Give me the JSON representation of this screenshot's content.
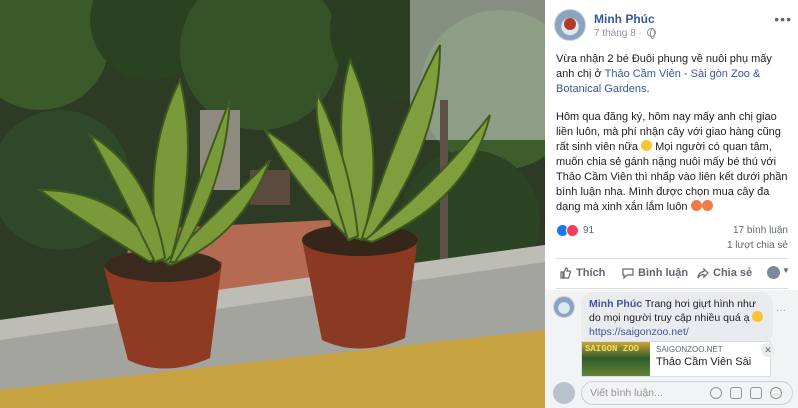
{
  "post": {
    "author": "Minh Phúc",
    "date": "7 tháng 8 ·",
    "more": "•••",
    "paragraph1_prefix": "Vừa nhận 2 bé Đuôi phụng về nuôi phụ mấy anh chị ở ",
    "paragraph1_link": "Thảo Cầm Viên - Sài gòn Zoo & Botanical Gardens",
    "paragraph1_suffix": ".",
    "paragraph2_a": "Hôm qua đăng ký, hôm nay mấy anh chị giao liền luôn, mà phí nhận cây với giao hàng cũng rất sinh viên nữa ",
    "paragraph2_b": " Mọi người có quan tâm, muốn chia sẻ gánh nặng nuôi mấy bé thú với Thảo Cầm Viên thì nhấp vào liên kết dưới phần bình luận nha. Mình được chọn mua cây đa dạng mà xinh xắn lắm luôn "
  },
  "stats": {
    "reactions": "91",
    "comments": "17 bình luận",
    "shares": "1 lượt chia sẻ"
  },
  "actions": {
    "like": "Thích",
    "comment": "Bình luận",
    "share": "Chia sẻ",
    "caret": "▼"
  },
  "comment": {
    "author": "Minh Phúc",
    "text": " Trang hơi giựt hình như do mọi người truy cập nhiều quá ạ ",
    "link": "https://saigonzoo.net/",
    "more": "···"
  },
  "preview": {
    "image_text": "SAIGON ZOO",
    "domain": "SAIGONZOO.NET",
    "title": "Thảo Cầm Viên Sài",
    "close": "✕"
  },
  "composer": {
    "placeholder": "Viết bình luận..."
  },
  "colors": {
    "link": "#385898",
    "like_blue": "#1877f2",
    "love_red": "#f33e58"
  }
}
